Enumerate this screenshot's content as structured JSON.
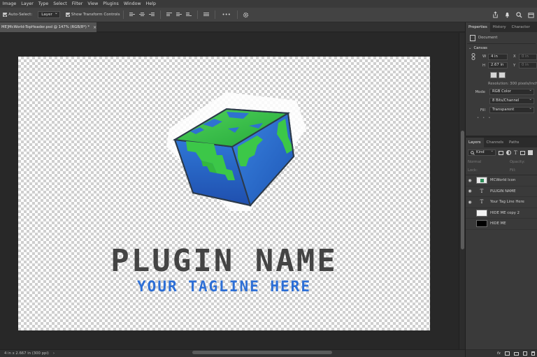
{
  "menu": [
    "Image",
    "Layer",
    "Type",
    "Select",
    "Filter",
    "View",
    "Plugins",
    "Window",
    "Help"
  ],
  "options": {
    "auto_select_label": "Auto-Select:",
    "auto_select_value": "Layer",
    "show_transform_label": "Show Transform Controls",
    "more_label": "•••"
  },
  "doc_tab": {
    "title": "ME]McWorld-TopHeader.psd @ 147% (RGB/8*) *",
    "close": "×"
  },
  "canvas": {
    "plugin_name": "PLUGIN NAME",
    "tagline": "YOUR TAGLINE HERE",
    "cube_colors": {
      "blue": "#2f72d0",
      "green": "#38c743",
      "outline": "#2c3a4a"
    }
  },
  "status": {
    "text": "4 in x 2.667 in (300 ppi)",
    "arrow": "›"
  },
  "properties": {
    "tabs": [
      "Properties",
      "History",
      "Character"
    ],
    "document_label": "Document",
    "canvas_section": "Canvas",
    "w_label": "W",
    "w_value": "4 in",
    "x_label": "X",
    "x_value": "0 in",
    "h_label": "H",
    "h_value": "2.67 in",
    "y_label": "Y",
    "y_value": "0 in",
    "resolution": "Resolution: 300 pixels/inch",
    "mode_label": "Mode",
    "mode_value": "RGB Color",
    "depth_value": "8 Bits/Channel",
    "fill_label": "Fill",
    "fill_value": "Transparent"
  },
  "layers": {
    "tabs": [
      "Layers",
      "Channels",
      "Paths"
    ],
    "kind_label": "Kind",
    "blend_mode": "Normal",
    "opacity_label": "Opacity:",
    "lock_label": "Lock:",
    "fill_label": "Fill:",
    "items": [
      {
        "name": "MCWorld Icon",
        "type": "image",
        "visible": true
      },
      {
        "name": "PLUGIN NAME",
        "type": "text",
        "visible": true
      },
      {
        "name": "Your Tag Line Here",
        "type": "text",
        "visible": true
      },
      {
        "name": "HIDE ME copy 2",
        "type": "image-white",
        "visible": false
      },
      {
        "name": "HIDE ME",
        "type": "image-black",
        "visible": false
      }
    ]
  },
  "icons": [
    "share-icon",
    "bell-icon",
    "search-icon",
    "window-icon",
    "gear-icon",
    "link-icon",
    "eye-icon",
    "text-layer-icon",
    "trash-icon",
    "new-layer-icon",
    "folder-icon",
    "fx-icon",
    "mask-icon"
  ]
}
